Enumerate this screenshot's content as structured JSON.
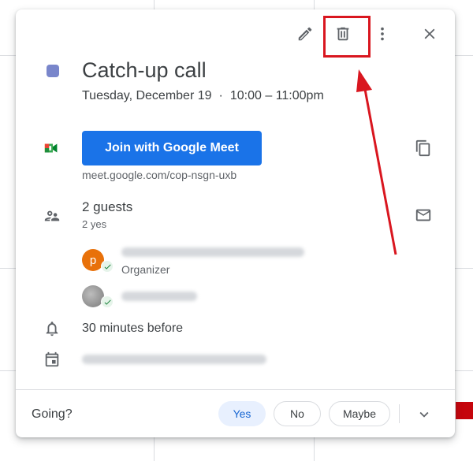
{
  "toolbar": {
    "edit_icon": "pencil-icon",
    "delete_icon": "trash-icon",
    "options_icon": "more-vert-icon",
    "close_icon": "close-icon"
  },
  "event": {
    "color": "#7986cb",
    "title": "Catch-up call",
    "date": "Tuesday, December 19",
    "separator": "·",
    "time": "10:00 – 11:00pm"
  },
  "meet": {
    "button_label": "Join with Google Meet",
    "link": "meet.google.com/cop-nsgn-uxb",
    "icon": "google-meet-icon",
    "copy_icon": "copy-icon"
  },
  "guests": {
    "title": "2 guests",
    "summary": "2 yes",
    "email_icon": "mail-icon",
    "list": [
      {
        "initial": "p",
        "role": "Organizer",
        "avatar_color": "#e8710a"
      },
      {
        "initial": "",
        "role": "",
        "avatar_color": "#9aa0a6"
      }
    ]
  },
  "reminder": {
    "text": "30 minutes before",
    "icon": "bell-icon"
  },
  "calendar": {
    "icon": "calendar-icon"
  },
  "rsvp": {
    "prompt": "Going?",
    "yes": "Yes",
    "no": "No",
    "maybe": "Maybe",
    "expand_icon": "chevron-down-icon"
  },
  "colors": {
    "accent": "#1a73e8",
    "annotation": "#d9161f"
  }
}
